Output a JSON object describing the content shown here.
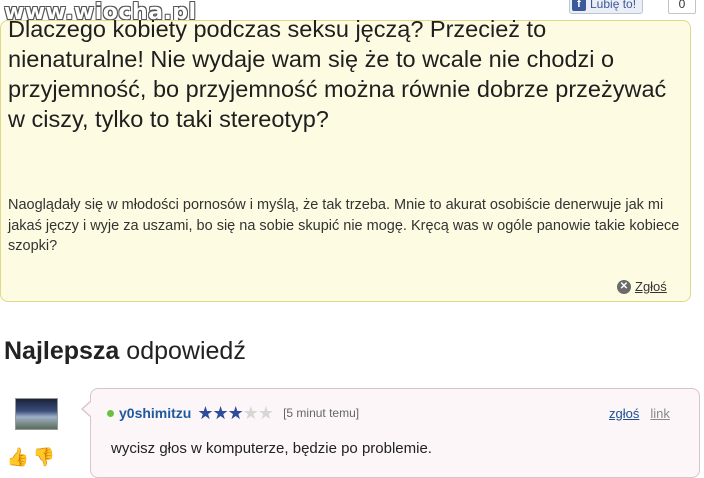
{
  "watermark": {
    "text": "www.wiocha.pl"
  },
  "facebook": {
    "like_label": "Lubię to!",
    "like_count": "0",
    "icon": "facebook-f-icon"
  },
  "question": {
    "title": "Dlaczego kobiety podczas seksu jęczą? Przecież to nienaturalne! Nie wydaje wam się że to wcale nie chodzi o przyjemność, bo przyjemność można równie dobrze przeżywać w ciszy, tylko to taki stereotyp?",
    "details": "Naoglądały się w młodości pornosów i myślą, że tak trzeba. Mnie to akurat osobiście denerwuje jak mi jakaś jęczy i wyje za uszami, bo się na sobie skupić nie mogę. Kręcą was w ogóle panowie takie kobiece szopki?",
    "report_label": "Zgłoś",
    "report_icon": "close-circle-icon"
  },
  "best_answer": {
    "heading_bold": "Najlepsza",
    "heading_rest": " odpowiedź",
    "username": "y0shimitzu",
    "rating": {
      "value": 3,
      "max": 5
    },
    "time": "[5 minut temu]",
    "report_label": "zgłoś",
    "link_label": "link",
    "text": "wycisz głos w komputerze, będzie po problemie.",
    "vote_up_icon": "thumbs-up-icon",
    "vote_down_icon": "thumbs-down-icon"
  },
  "colors": {
    "question_bg": "#fdfbe2",
    "answer_bg": "#fcf6f8",
    "username": "#1d5a9e",
    "star": "#2f4b9c"
  }
}
